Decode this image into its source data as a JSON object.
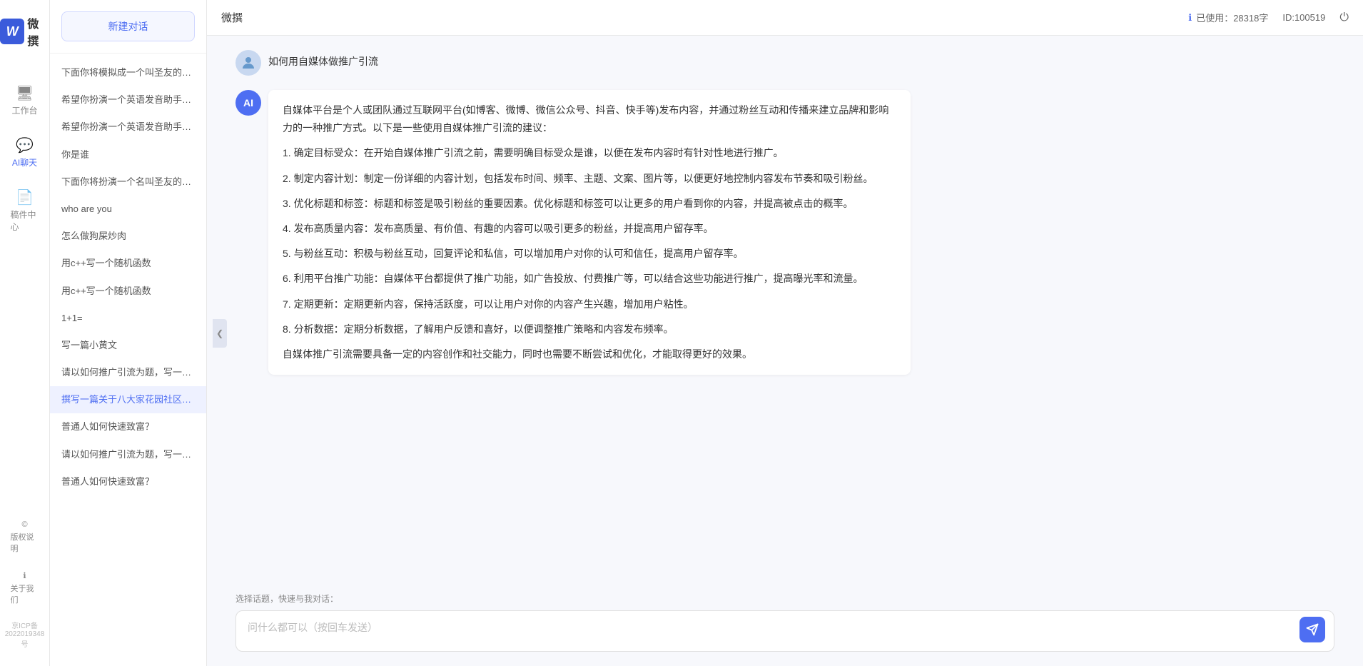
{
  "app": {
    "title": "微撰",
    "logo_letter": "W",
    "logo_text": "微撰"
  },
  "top_bar": {
    "title": "微撰",
    "usage_label": "已使用：28318字",
    "id_label": "ID:100519",
    "usage_icon": "ℹ"
  },
  "nav": {
    "items": [
      {
        "id": "workbench",
        "label": "工作台",
        "icon": "🖥"
      },
      {
        "id": "ai-chat",
        "label": "AI聊天",
        "icon": "💬",
        "active": true
      },
      {
        "id": "draft",
        "label": "稿件中心",
        "icon": "📄"
      }
    ],
    "bottom_items": [
      {
        "id": "copyright",
        "label": "版权说明",
        "icon": "©"
      },
      {
        "id": "about",
        "label": "关于我们",
        "icon": "ℹ"
      }
    ],
    "icp": "京ICP备2022019348号"
  },
  "sidebar": {
    "new_chat_label": "新建对话",
    "items": [
      {
        "id": 1,
        "text": "下面你将模拟成一个叫圣友的程序员，我说...",
        "active": false
      },
      {
        "id": 2,
        "text": "希望你扮演一个英语发音助手，我提供给你...",
        "active": false
      },
      {
        "id": 3,
        "text": "希望你扮演一个英语发音助手，我提供给你...",
        "active": false
      },
      {
        "id": 4,
        "text": "你是谁",
        "active": false
      },
      {
        "id": 5,
        "text": "下面你将扮演一个名叫圣友的医生",
        "active": false
      },
      {
        "id": 6,
        "text": "who are you",
        "active": false
      },
      {
        "id": 7,
        "text": "怎么做狗屎炒肉",
        "active": false
      },
      {
        "id": 8,
        "text": "用c++写一个随机函数",
        "active": false
      },
      {
        "id": 9,
        "text": "用c++写一个随机函数",
        "active": false
      },
      {
        "id": 10,
        "text": "1+1=",
        "active": false
      },
      {
        "id": 11,
        "text": "写一篇小黄文",
        "active": false
      },
      {
        "id": 12,
        "text": "请以如何推广引流为题，写一篇大纲",
        "active": false
      },
      {
        "id": 13,
        "text": "撰写一篇关于八大家花园社区一刻钟便民生...",
        "active": true
      },
      {
        "id": 14,
        "text": "普通人如何快速致富？",
        "active": false
      },
      {
        "id": 15,
        "text": "请以如何推广引流为题，写一篇大纲",
        "active": false
      },
      {
        "id": 16,
        "text": "普通人如何快速致富？",
        "active": false
      }
    ]
  },
  "chat": {
    "user_message": "如何用自媒体做推广引流",
    "user_avatar_icon": "👤",
    "ai_avatar_text": "AI",
    "ai_response": {
      "paragraphs": [
        "自媒体平台是个人或团队通过互联网平台(如博客、微博、微信公众号、抖音、快手等)发布内容，并通过粉丝互动和传播来建立品牌和影响力的一种推广方式。以下是一些使用自媒体推广引流的建议：",
        "1. 确定目标受众：在开始自媒体推广引流之前，需要明确目标受众是谁，以便在发布内容时有针对性地进行推广。",
        "2. 制定内容计划：制定一份详细的内容计划，包括发布时间、频率、主题、文案、图片等，以便更好地控制内容发布节奏和吸引粉丝。",
        "3. 优化标题和标签：标题和标签是吸引粉丝的重要因素。优化标题和标签可以让更多的用户看到你的内容，并提高被点击的概率。",
        "4. 发布高质量内容：发布高质量、有价值、有趣的内容可以吸引更多的粉丝，并提高用户留存率。",
        "5. 与粉丝互动：积极与粉丝互动，回复评论和私信，可以增加用户对你的认可和信任，提高用户留存率。",
        "6. 利用平台推广功能：自媒体平台都提供了推广功能，如广告投放、付费推广等，可以结合这些功能进行推广，提高曝光率和流量。",
        "7. 定期更新：定期更新内容，保持活跃度，可以让用户对你的内容产生兴趣，增加用户粘性。",
        "8. 分析数据：定期分析数据，了解用户反馈和喜好，以便调整推广策略和内容发布频率。",
        "自媒体推广引流需要具备一定的内容创作和社交能力，同时也需要不断尝试和优化，才能取得更好的效果。"
      ]
    }
  },
  "input": {
    "quick_select_label": "选择话题，快速与我对话：",
    "placeholder": "问什么都可以（按回车发送）",
    "send_icon": "➤"
  }
}
